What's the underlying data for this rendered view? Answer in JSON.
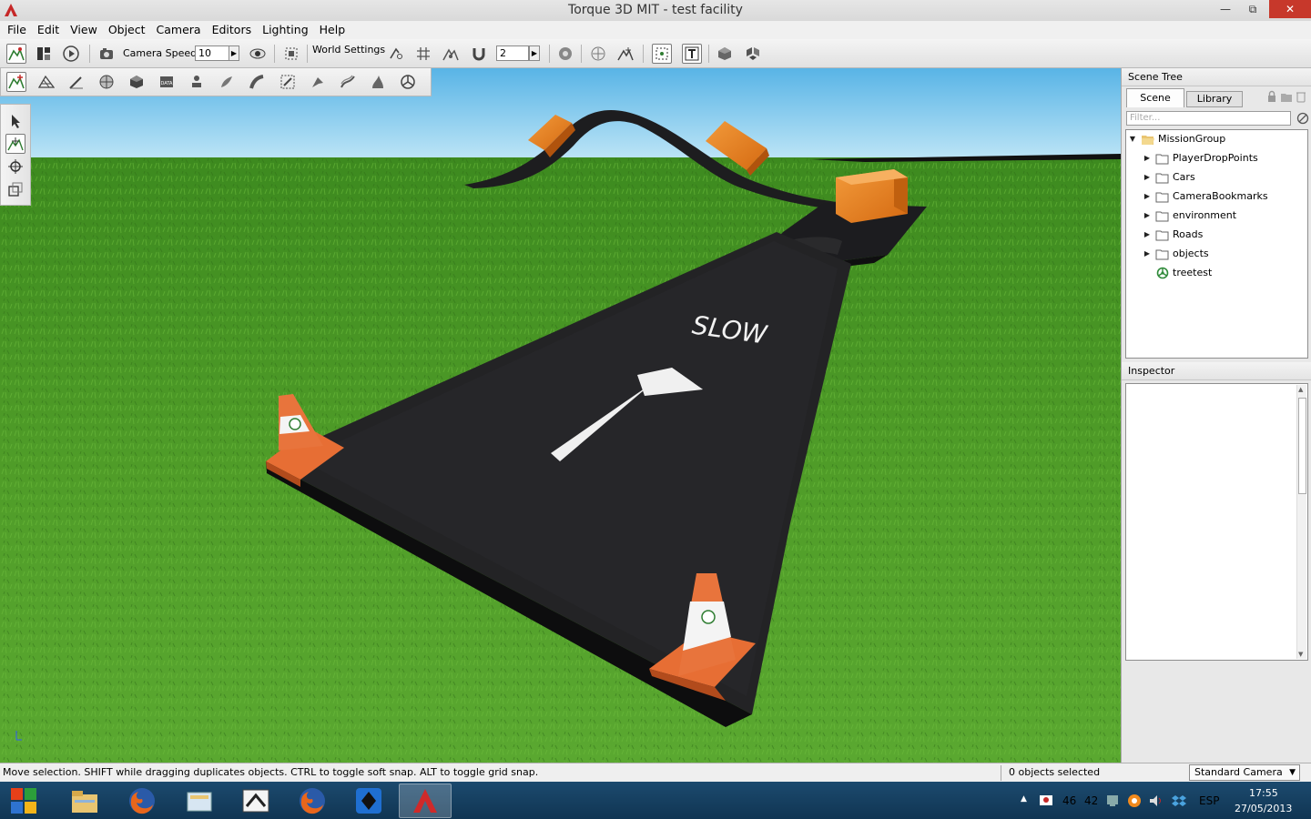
{
  "window": {
    "title": "Torque 3D MIT - test facility",
    "minimize": "—",
    "maximize": "⧉",
    "close": "✕"
  },
  "menu": [
    "File",
    "Edit",
    "View",
    "Object",
    "Camera",
    "Editors",
    "Lighting",
    "Help"
  ],
  "toolbar": {
    "camera_speed_label": "Camera Speed",
    "camera_speed_value": "10",
    "world_settings_label": "World Settings",
    "snap_value": "2"
  },
  "scene_tree": {
    "header": "Scene Tree",
    "tabs": [
      "Scene",
      "Library"
    ],
    "filter_placeholder": "Filter...",
    "items": [
      {
        "label": "MissionGroup",
        "icon": "open-folder-icon"
      },
      {
        "label": "PlayerDropPoints",
        "icon": "folder-icon"
      },
      {
        "label": "Cars",
        "icon": "folder-icon"
      },
      {
        "label": "CameraBookmarks",
        "icon": "folder-icon"
      },
      {
        "label": "environment",
        "icon": "folder-icon"
      },
      {
        "label": "Roads",
        "icon": "folder-icon"
      },
      {
        "label": "objects",
        "icon": "folder-icon"
      },
      {
        "label": "treetest",
        "icon": "tree-icon"
      }
    ]
  },
  "inspector": {
    "header": "Inspector"
  },
  "viewport": {
    "road_text": "SLOW",
    "colors": {
      "sky": "#7cc6ec",
      "grass": "#4f9a26",
      "asphalt": "#1e1f22",
      "crate": "#ec7a1c",
      "cone": "#e8743c"
    }
  },
  "statusbar": {
    "message": "Move selection.  SHIFT while dragging duplicates objects.  CTRL to toggle soft snap.  ALT to toggle grid snap.",
    "selection": "0 objects selected",
    "camera_mode": "Standard Camera"
  },
  "taskbar": {
    "apps": [
      "start-icon",
      "file-explorer-icon",
      "firefox-icon",
      "folder-app-icon",
      "torque-toolbox-icon",
      "firefox-icon",
      "steam-icon",
      "torque-3d-icon"
    ],
    "tray": {
      "v1": "46",
      "v2": "42",
      "lang": "ESP",
      "time": "17:55",
      "date": "27/05/2013"
    }
  }
}
